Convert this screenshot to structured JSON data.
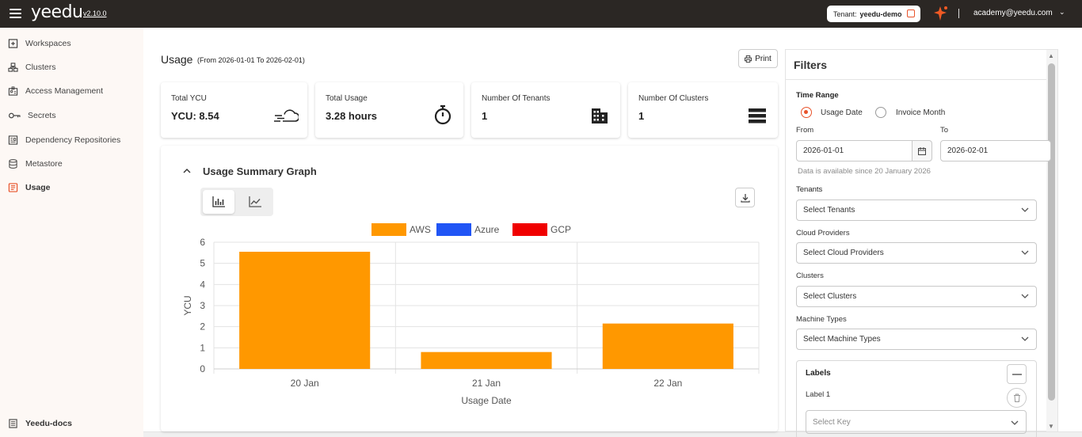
{
  "header": {
    "logo": "yeedu",
    "version": "v2.10.0",
    "tenant_label": "Tenant:",
    "tenant_value": "yeedu-demo",
    "account": "academy@yeedu.com"
  },
  "sidebar": {
    "items": [
      {
        "label": "Workspaces",
        "icon": "add-box-icon",
        "active": false
      },
      {
        "label": "Clusters",
        "icon": "cluster-icon",
        "active": false
      },
      {
        "label": "Access Management",
        "icon": "badge-icon",
        "active": false
      },
      {
        "label": "Secrets",
        "icon": "key-icon",
        "active": false
      },
      {
        "label": "Dependency Repositories",
        "icon": "repository-icon",
        "active": false
      },
      {
        "label": "Metastore",
        "icon": "database-icon",
        "active": false
      },
      {
        "label": "Usage",
        "icon": "usage-icon",
        "active": true
      }
    ],
    "footer_label": "Yeedu-docs"
  },
  "page": {
    "title": "Usage",
    "subtitle": "(From 2026-01-01 To 2026-02-01)",
    "print_label": "Print"
  },
  "stats": [
    {
      "label": "Total YCU",
      "value": "YCU: 8.54",
      "icon": "cloud-speed-icon"
    },
    {
      "label": "Total Usage",
      "value": "3.28 hours",
      "icon": "stopwatch-icon"
    },
    {
      "label": "Number Of Tenants",
      "value": "1",
      "icon": "building-icon"
    },
    {
      "label": "Number Of Clusters",
      "value": "1",
      "icon": "server-stack-icon"
    }
  ],
  "graph": {
    "title": "Usage Summary Graph"
  },
  "chart_data": {
    "type": "bar",
    "categories": [
      "20 Jan",
      "21 Jan",
      "22 Jan"
    ],
    "series": [
      {
        "name": "AWS",
        "values": [
          5.55,
          0.8,
          2.15
        ],
        "color": "#ff9800"
      },
      {
        "name": "Azure",
        "values": [
          0,
          0,
          0
        ],
        "color": "#2155f5"
      },
      {
        "name": "GCP",
        "values": [
          0,
          0,
          0
        ],
        "color": "#f00000"
      }
    ],
    "xlabel": "Usage Date",
    "ylabel": "YCU",
    "ylim": [
      0,
      6
    ],
    "yticks": [
      "0",
      "1",
      "2",
      "3",
      "4",
      "5",
      "6"
    ],
    "grid": true,
    "legend": "top-center"
  },
  "filters": {
    "title": "Filters",
    "time_range_label": "Time Range",
    "radio_usage": "Usage Date",
    "radio_invoice": "Invoice Month",
    "from_label": "From",
    "to_label": "To",
    "from_value": "2026-01-01",
    "to_value": "2026-02-01",
    "hint": "Data is available since 20 January 2026",
    "tenants_label": "Tenants",
    "tenants_placeholder": "Select Tenants",
    "cloud_label": "Cloud Providers",
    "cloud_placeholder": "Select Cloud Providers",
    "clusters_label": "Clusters",
    "clusters_placeholder": "Select Clusters",
    "machine_label": "Machine Types",
    "machine_placeholder": "Select Machine Types",
    "labels_title": "Labels",
    "label1": "Label 1",
    "key_placeholder": "Select Key"
  }
}
